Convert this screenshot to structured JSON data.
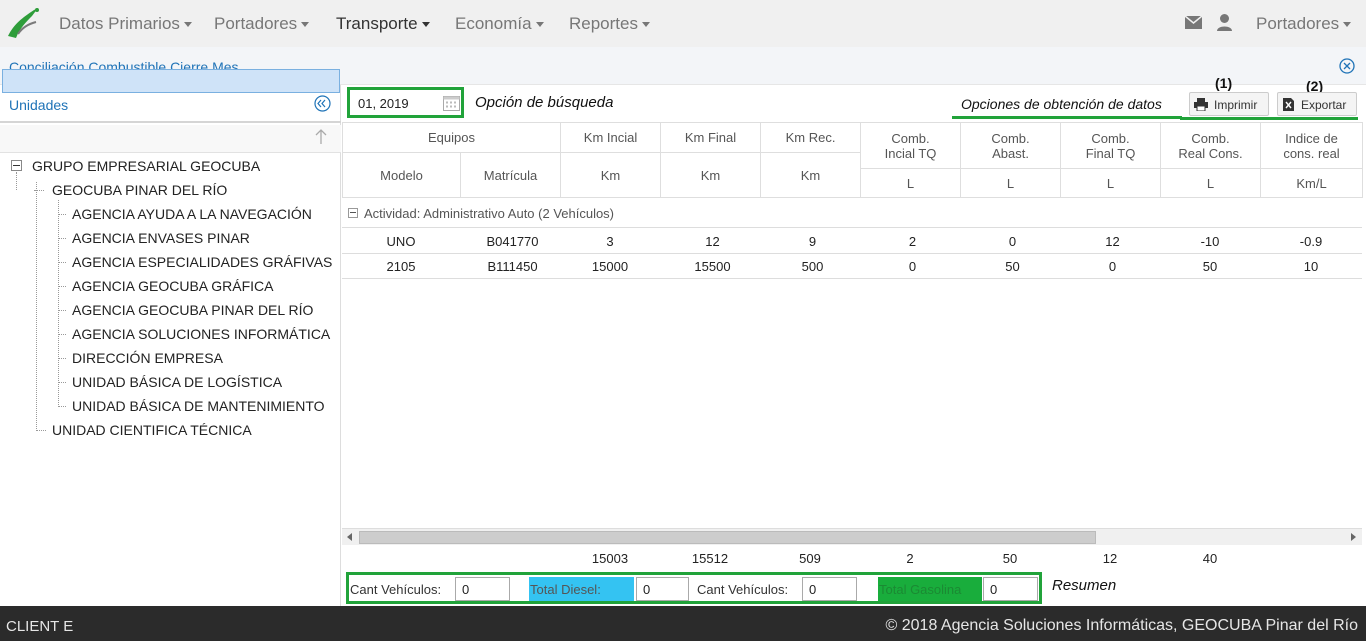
{
  "navbar": {
    "menu": [
      {
        "label": "Datos Primarios"
      },
      {
        "label": "Portadores"
      },
      {
        "label": "Transporte"
      },
      {
        "label": "Economía"
      },
      {
        "label": "Reportes"
      }
    ],
    "user_menu_label": "Portadores"
  },
  "page": {
    "title": "Conciliación Combustible Cierre Mes"
  },
  "left_panel": {
    "title": "Unidades",
    "tree": {
      "root": "GRUPO EMPRESARIAL GEOCUBA",
      "branch": "GEOCUBA PINAR DEL RÍO",
      "children": [
        "AGENCIA AYUDA A LA NAVEGACIÓN",
        "AGENCIA ENVASES PINAR",
        "AGENCIA ESPECIALIDADES GRÁFIVAS",
        "AGENCIA GEOCUBA GRÁFICA",
        "AGENCIA GEOCUBA PINAR DEL RÍO",
        "AGENCIA SOLUCIONES INFORMÁTICA",
        "DIRECCIÓN EMPRESA",
        "UNIDAD BÁSICA DE LOGÍSTICA",
        "UNIDAD BÁSICA DE MANTENIMIENTO"
      ],
      "sibling": "UNIDAD CIENTIFICA TÉCNICA"
    }
  },
  "toolbar": {
    "date_value": "01, 2019",
    "search_annotation": "Opción de búsqueda",
    "data_options_annotation": "Opciones de obtención de datos",
    "print_label": "Imprimir",
    "print_number": "(1)",
    "export_label": "Exportar",
    "export_number": "(2)"
  },
  "grid": {
    "headers": {
      "equipos": "Equipos",
      "modelo": "Modelo",
      "matricula": "Matrícula",
      "km_inicial": "Km Incial",
      "km_final": "Km Final",
      "km_rec": "Km Rec.",
      "km_unit": "Km",
      "comb_inicial_1": "Comb.",
      "comb_inicial_2": "Incial TQ",
      "comb_abast_1": "Comb.",
      "comb_abast_2": "Abast.",
      "comb_final_1": "Comb.",
      "comb_final_2": "Final TQ",
      "comb_real_1": "Comb.",
      "comb_real_2": "Real Cons.",
      "indice_1": "Indice de",
      "indice_2": "cons. real",
      "l_unit": "L",
      "kml_unit": "Km/L"
    },
    "group_label": "Actividad: Administrativo Auto (2 Vehículos)",
    "rows": [
      {
        "modelo": "UNO",
        "matricula": "B041770",
        "km_inicial": "3",
        "km_final": "12",
        "km_rec": "9",
        "comb_inicial": "2",
        "comb_abast": "0",
        "comb_final": "12",
        "comb_real": "-10",
        "indice": "-0.9"
      },
      {
        "modelo": "2105",
        "matricula": "B111450",
        "km_inicial": "15000",
        "km_final": "15500",
        "km_rec": "500",
        "comb_inicial": "0",
        "comb_abast": "50",
        "comb_final": "0",
        "comb_real": "50",
        "indice": "10"
      }
    ],
    "totals": {
      "km_inicial": "15003",
      "km_final": "15512",
      "km_rec": "509",
      "comb_inicial": "2",
      "comb_abast": "50",
      "comb_final": "12",
      "comb_real": "40"
    }
  },
  "summary": {
    "cant_vehiculos_label": "Cant Vehículos:",
    "cant_vehiculos_diesel_value": "0",
    "total_diesel_label": "Total Diesel:",
    "total_diesel_value": "0",
    "cant_vehiculos_gasolina_value": "0",
    "total_gasolina_label": "Total Gasolina",
    "total_gasolina_value": "0",
    "annotation": "Resumen"
  },
  "footer": {
    "left": "CLIENT E",
    "right": "© 2018 Agencia Soluciones Informáticas, GEOCUBA Pinar del Río"
  },
  "colors": {
    "accent_blue": "#1f73b7",
    "highlight_green": "#21a33a",
    "diesel_blue": "#34c3f2",
    "gasolina_green": "#19ad3c",
    "footer_bg": "#2b2b2b"
  }
}
